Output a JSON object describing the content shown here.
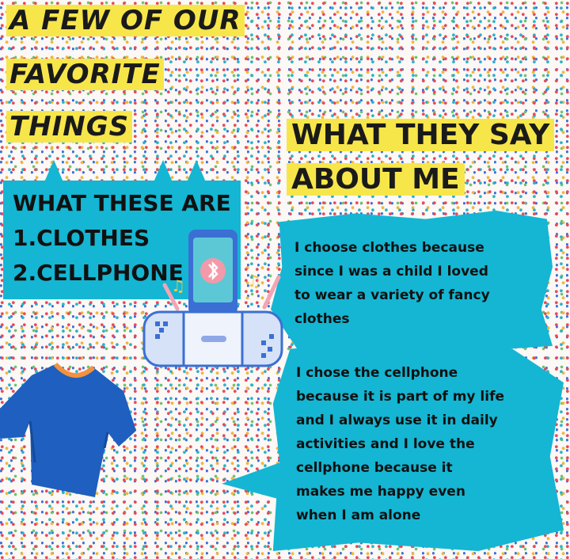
{
  "title": {
    "line1": "A FEW OF OUR",
    "line2": "FAVORITE",
    "line3": "THINGS"
  },
  "list_box": {
    "heading": "WHAT THESE ARE",
    "item1": "1.CLOTHES",
    "item2": "2.CELLPHONE"
  },
  "side_heading": {
    "line1": "WHAT THEY SAY",
    "line2": "ABOUT ME"
  },
  "quotes": {
    "clothes": "I choose clothes because\nsince I was a child I loved\nto wear a variety of fancy\nclothes",
    "cellphone": "I chose the cellphone\nbecause it is part of my life\nand I always use it in daily\nactivities and I love the\ncellphone because it\nmakes me happy even\nwhen I am alone"
  },
  "colors": {
    "accent_cyan": "#14b6d3",
    "highlight_yellow": "#f7e64a",
    "shirt_blue": "#1e5fbf"
  },
  "icons": [
    "phone-speaker-icon",
    "bluetooth-icon",
    "music-note-icon",
    "t-shirt-icon"
  ]
}
